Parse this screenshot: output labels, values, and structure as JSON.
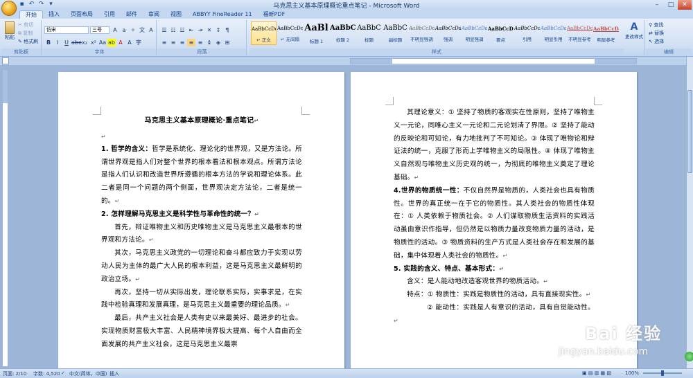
{
  "window": {
    "title": "马克思主义基本原理概论重点笔记 - Microsoft Word"
  },
  "tabs": [
    "开始",
    "插入",
    "页面布局",
    "引用",
    "邮件",
    "审阅",
    "视图",
    "ABBYY FineReader 11",
    "福昕PDF"
  ],
  "ribbon": {
    "clipboard": {
      "paste": "粘贴",
      "cut": "剪切",
      "copy": "复制",
      "format_painter": "格式刷",
      "label": "剪贴板"
    },
    "font": {
      "name": "仿宋",
      "size": "三号",
      "label": "字体"
    },
    "paragraph": {
      "label": "段落"
    },
    "styles": {
      "label": "样式",
      "items": [
        {
          "sample": "AaBbCcDc",
          "name": "↵ 正文"
        },
        {
          "sample": "AaBbCcDc",
          "name": "↵ 无间隔"
        },
        {
          "sample": "AaBl",
          "name": "标题 1"
        },
        {
          "sample": "AaBbC",
          "name": "标题 2"
        },
        {
          "sample": "AaBbC",
          "name": "标题"
        },
        {
          "sample": "AaBbC",
          "name": "副标题"
        },
        {
          "sample": "AaBbCcDd",
          "name": "不明显强调"
        },
        {
          "sample": "AaBbCcDd",
          "name": "强调"
        },
        {
          "sample": "AaBbCcDd",
          "name": "明显强调"
        },
        {
          "sample": "AaBbCcDc",
          "name": "要点"
        },
        {
          "sample": "AaBbCcDc",
          "name": "引用"
        },
        {
          "sample": "AaBbCcDd",
          "name": "明显引用"
        },
        {
          "sample": "AaBbCcDd",
          "name": "不明显参考"
        },
        {
          "sample": "AaBbCcDd",
          "name": "明显参考"
        }
      ],
      "change_styles": "更改样式"
    },
    "editing": {
      "find": "查找",
      "replace": "替换",
      "select": "选择",
      "label": "编辑"
    }
  },
  "page1": {
    "title": "马克思主义基本原理概论·重点笔记",
    "h1_num": "1.",
    "h1_label": "哲学的含义：",
    "h1_text": "哲学是系统化、理论化的世界观，又是方法论。所谓世界观是指人们对整个世界的根本看法和根本观点。所谓方法论是指人们认识和改造世界所遵循的根本方法的学说和理论体系。此二者是同一个问题的两个侧面，世界观决定方法论，二者是统一的。",
    "h2": "2. 怎样理解马克思主义是科学性与革命性的统一？",
    "p1": "首先，辩证唯物主义和历史唯物主义是马克思主义最根本的世界观和方法论。",
    "p2": "其次，马克思主义政党的一切理论和奋斗都应致力于实现以劳动人民为主体的最广大人民的根本利益，这是马克思主义最鲜明的政治立场。",
    "p3": "再次，坚持一切从实际出发，理论联系实际，实事求是，在实践中检验真理和发展真理，是马克思主义最重要的理论品质。",
    "p4": "最后，共产主义社会是人类有史以来最美好、最进步的社会。实现物质财富极大丰富、人民精神境界极大提高、每个人自由而全面发展的共产主义社会，这是马克思主义最崇"
  },
  "page2": {
    "p1": "其理论意义：① 坚持了物质的客观实在性原则，坚持了唯物主义一元论，同唯心主义一元论和二元论划清了界限。② 坚持了能动的反映论和可知论，有力地批判了不可知论。③ 体现了唯物论和辩证法的统一，克服了形而上学唯物主义的局限性。④ 体现了唯物主义自然观与唯物主义历史观的统一，为彻底的唯物主义奠定了理论基础。",
    "h4_label": "4.世界的物质统一性：",
    "h4_text": "不仅自然界是物质的，人类社会也具有物质性。世界的真正统一在于它的物质性。其人类社会的物质性体现在：① 人类依赖于物质社会。② 人们谋取物质生活资料的实践活动虽由意识作指导，但仍然是以物质力量改变物质力量的活动，是物质性的活动。③ 物质资料的生产方式是人类社会存在和发展的基础，集中体现着人类社会的物质性。",
    "h5": "5. 实践的含义、特点、基本形式：",
    "p_def": "含义：是人能动地改造客观世界的物质活动。",
    "p_feat": "特点：① 物质性：实践是物质性的活动，具有直接现实性。",
    "p_feat2": "② 能动性：实践是人有意识的活动，具有自觉能动性。"
  },
  "statusbar": {
    "page": "页面: 2/10",
    "words": "字数: 4,520",
    "lang": "中文(简体，中国)",
    "mode": "插入",
    "zoom": "100%"
  },
  "watermark": {
    "brand": "Bai 经验",
    "url": "jingyan.baidu.com"
  }
}
